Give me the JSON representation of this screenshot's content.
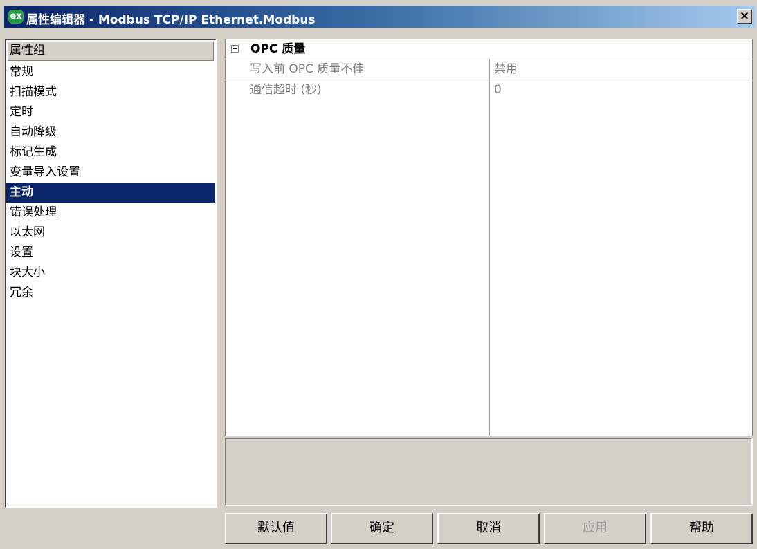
{
  "window": {
    "icon_text": "ex",
    "title": "属性编辑器 - Modbus TCP/IP Ethernet.Modbus",
    "close_label": "×"
  },
  "groups": {
    "header": "属性组",
    "items": [
      {
        "label": "常规"
      },
      {
        "label": "扫描模式"
      },
      {
        "label": "定时"
      },
      {
        "label": "自动降级"
      },
      {
        "label": "标记生成"
      },
      {
        "label": "变量导入设置"
      },
      {
        "label": "主动",
        "selected": true
      },
      {
        "label": "错误处理"
      },
      {
        "label": "以太网"
      },
      {
        "label": "设置"
      },
      {
        "label": "块大小"
      },
      {
        "label": "冗余"
      }
    ]
  },
  "grid": {
    "section_title": "OPC 质量",
    "rows": [
      {
        "name": "写入前 OPC 质量不佳",
        "value": "禁用"
      },
      {
        "name": "通信超时 (秒)",
        "value": "0"
      }
    ]
  },
  "buttons": {
    "default": "默认值",
    "ok": "确定",
    "cancel": "取消",
    "apply": "应用",
    "help": "帮助"
  },
  "colors": {
    "selection": "#0a246a",
    "face": "#d4d0c8"
  }
}
